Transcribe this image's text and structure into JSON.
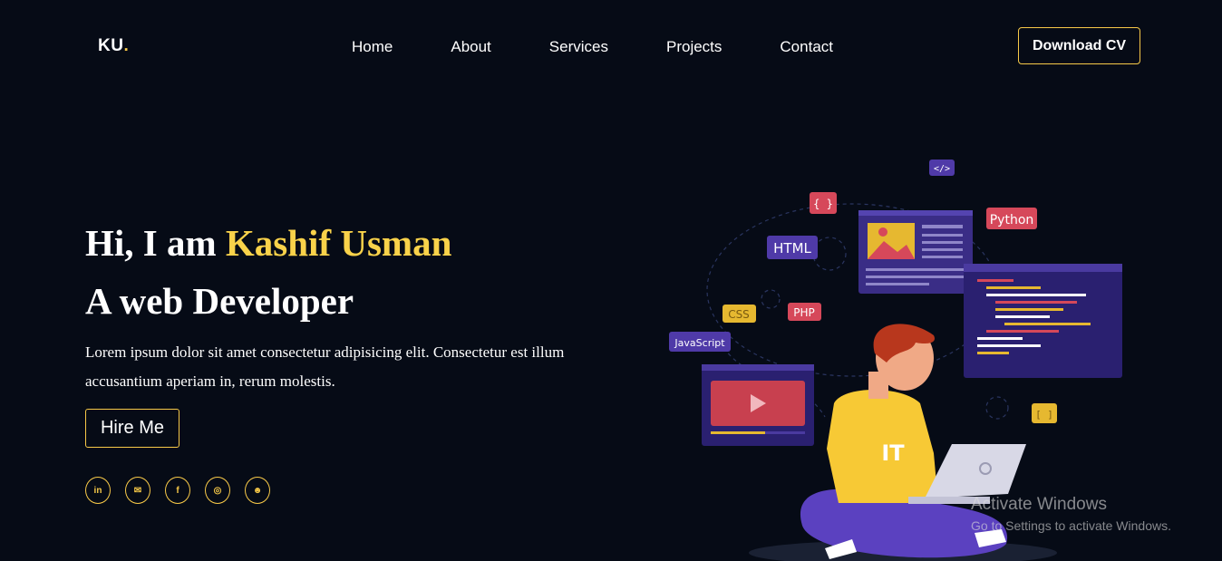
{
  "header": {
    "logo_text": "KU",
    "logo_dot": ".",
    "nav": [
      "Home",
      "About",
      "Services",
      "Projects",
      "Contact"
    ],
    "download_label": "Download CV"
  },
  "hero": {
    "greeting": "Hi, I am ",
    "name": "Kashif Usman",
    "role": "A web Developer",
    "description": "Lorem ipsum dolor sit amet consectetur adipisicing elit. Consectetur est illum accusantium aperiam in, rerum molestis.",
    "hire_label": "Hire Me"
  },
  "socials": [
    {
      "name": "linkedin-icon",
      "glyph": "in"
    },
    {
      "name": "mail-icon",
      "glyph": "✉"
    },
    {
      "name": "facebook-icon",
      "glyph": "f"
    },
    {
      "name": "instagram-icon",
      "glyph": "◎"
    },
    {
      "name": "discord-icon",
      "glyph": "☻"
    }
  ],
  "illustration": {
    "tags": [
      "</>",
      "{ }",
      "HTML",
      "Python",
      "CSS",
      "PHP",
      "JavaScript",
      "[ ]"
    ],
    "shirt_text": "IT"
  },
  "watermark": {
    "title": "Activate Windows",
    "subtitle": "Go to Settings to activate Windows."
  },
  "colors": {
    "background": "#060b16",
    "accent": "#f7c948",
    "name_color": "#f9d24a"
  }
}
